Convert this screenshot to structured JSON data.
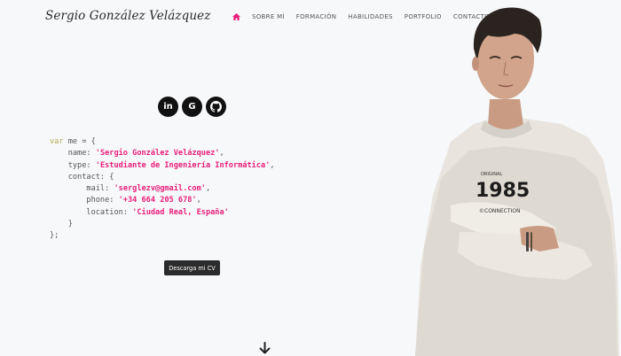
{
  "header": {
    "brand": "Sergio González Velázquez",
    "nav": [
      {
        "label": "SOBRE MÍ"
      },
      {
        "label": "FORMACIÓN"
      },
      {
        "label": "HABILIDADES"
      },
      {
        "label": "PORTFOLIO"
      },
      {
        "label": "CONTACTO"
      }
    ],
    "home_icon": "home-icon",
    "accent": "#e91e7a"
  },
  "social": [
    {
      "icon": "linkedin-icon",
      "glyph": "in"
    },
    {
      "icon": "google-icon",
      "glyph": "G"
    },
    {
      "icon": "github-icon"
    }
  ],
  "code": {
    "var": "var",
    "name": "me",
    "fields": {
      "name_key": "name",
      "name_value": "'Sergio González Velázquez'",
      "type_key": "type",
      "type_value": "'Estudiante de Ingeniería Informática'",
      "contact_key": "contact",
      "mail_key": "mail",
      "mail_value": "'serglezv@gmail.com'",
      "phone_key": "phone",
      "phone_value": "'+34 664 205 678'",
      "location_key": "location",
      "location_value": "'Ciudad Real, España'"
    }
  },
  "cv_button": "Descarga mi CV",
  "scroll_icon": "arrow-down-icon",
  "photo": {
    "shirt_text": "1985",
    "shirt_subtext": "©CONNECTION",
    "shirt_badge": "ORIGINAL"
  }
}
